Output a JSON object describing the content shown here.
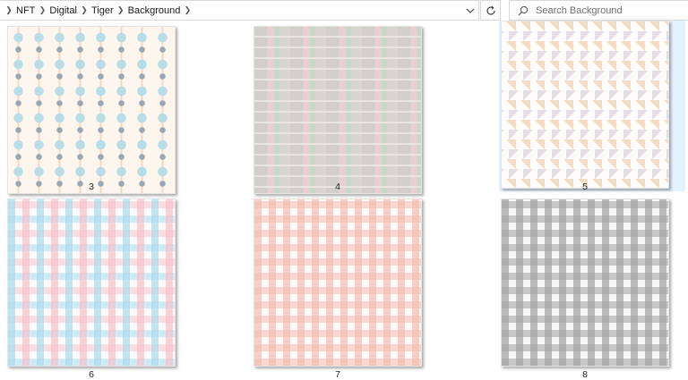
{
  "breadcrumb": {
    "items": [
      "NFT",
      "Digital",
      "Tiger",
      "Background"
    ]
  },
  "search": {
    "placeholder": "Search Background"
  },
  "icons": {
    "chevron": "chevron-right-icon",
    "dropdown": "chevron-down-icon",
    "refresh": "refresh-icon",
    "search": "search-icon"
  },
  "files": [
    {
      "name": "3",
      "pattern": "tulip-pattern",
      "selected": false
    },
    {
      "name": "4",
      "pattern": "dash-pattern",
      "selected": false
    },
    {
      "name": "5",
      "pattern": "triangle-pattern",
      "selected": true
    },
    {
      "name": "6",
      "pattern": "blue-pink-gingham",
      "selected": false
    },
    {
      "name": "7",
      "pattern": "peach-gingham",
      "selected": false
    },
    {
      "name": "8",
      "pattern": "gray-gingham",
      "selected": false
    }
  ],
  "colors": {
    "selection": "#cce8ff",
    "border": "#d9d9d9"
  }
}
